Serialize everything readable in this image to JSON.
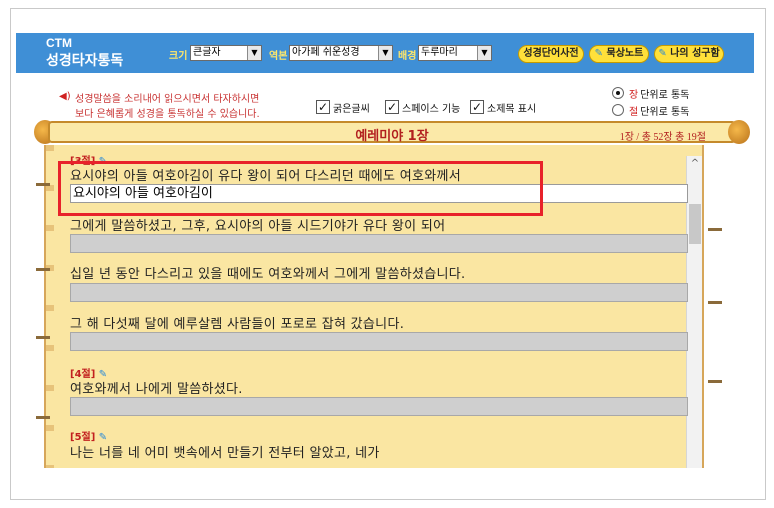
{
  "header": {
    "logo_top": "CTM",
    "logo_main": "성경타자통독",
    "size_label": "크기",
    "size_value": "큰글자",
    "version_label": "역본",
    "version_value": "아가페 쉬운성경",
    "bg_label": "배경",
    "bg_value": "두루마리",
    "btn_dictionary": "성경단어사전",
    "btn_meditation": "묵상노트",
    "btn_my_verses": "나의 성구함"
  },
  "notice": {
    "line1": "성경말씀을 소리내어 읽으시면서 타자하시면",
    "line2": "보다 은혜롭게 성경을 통독하실 수 있습니다."
  },
  "options": {
    "bold": "굵은글씨",
    "space": "스페이스 기능",
    "subtitle": "소제목 표시"
  },
  "mode": {
    "chapter_hl": "장",
    "chapter_rest": "단위로 통독",
    "verse_hl": "절",
    "verse_rest": "단위로 통독"
  },
  "reader": {
    "chapter_title": "예레미야 1장",
    "position": "1장 / 총 52장  총 19절"
  },
  "verses": {
    "v3_no": "[3절]",
    "v3_line1": "요시야의 아들 여호아김이 유다 왕이 되어 다스리던 때에도 여호와께서",
    "v3_typed": "요시야의 아들 여호아김이",
    "v3_line2": "그에게 말씀하셨고, 그후, 요시야의 아들 시드기야가 유다 왕이 되어",
    "v3_line3": "십일 년 동안 다스리고 있을 때에도 여호와께서 그에게 말씀하셨습니다.",
    "v3_line4": "그 해 다섯째 달에 예루살렘 사람들이 포로로 잡혀 갔습니다.",
    "v4_no": "[4절]",
    "v4_line1": "여호와께서 나에게 말씀하셨다.",
    "v5_no": "[5절]",
    "v5_line1": "나는 너를 네 어미 뱃속에서 만들기 전부터 알았고, 네가"
  },
  "colors": {
    "header_bg": "#3f8fd6",
    "label_yellow": "#ffe76a",
    "accent_red": "#c83232",
    "highlight_box": "#e8222a",
    "paper": "#fae6a2"
  }
}
